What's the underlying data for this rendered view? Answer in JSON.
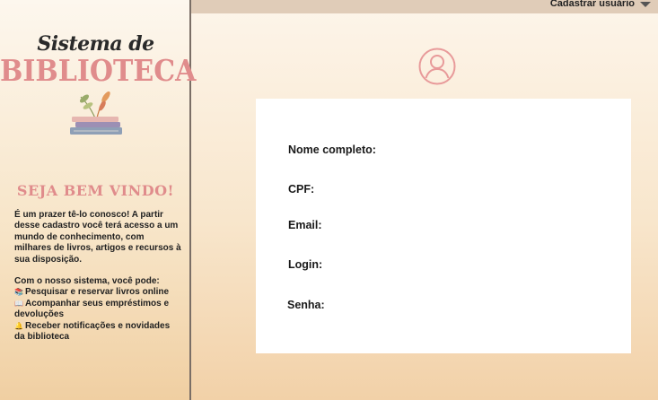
{
  "sidebar": {
    "logo_script": "Sistema de",
    "logo_title": "BIBLIOTECA",
    "welcome": "SEJA BEM VINDO!",
    "intro": "É um prazer tê-lo conosco! A partir desse cadastro você terá acesso a um mundo de conhecimento, com milhares de livros, artigos e recursos à sua disposição.",
    "features_heading": "Com o nosso sistema, você pode:",
    "features": [
      {
        "icon": "📚",
        "text": "Pesquisar e reservar livros online"
      },
      {
        "icon": "📖",
        "text": "Acompanhar seus empréstimos e devoluções"
      },
      {
        "icon": "🔔",
        "text": "Receber notificações e novidades da biblioteca"
      }
    ]
  },
  "topbar": {
    "menu_label": "Cadastrar usuário"
  },
  "form": {
    "fields": [
      {
        "label": "Nome completo:",
        "value": ""
      },
      {
        "label": "CPF:",
        "value": ""
      },
      {
        "label": "Email:",
        "value": ""
      },
      {
        "label": "Login:",
        "value": ""
      },
      {
        "label": "Senha:",
        "value": ""
      }
    ]
  },
  "colors": {
    "accent_pink": "#e08c8c",
    "avatar_stroke": "#e89a9a",
    "topbar": "#e0ccb8"
  },
  "icons": [
    "user-avatar-icon",
    "book-stack-icon",
    "chevron-down-icon"
  ]
}
